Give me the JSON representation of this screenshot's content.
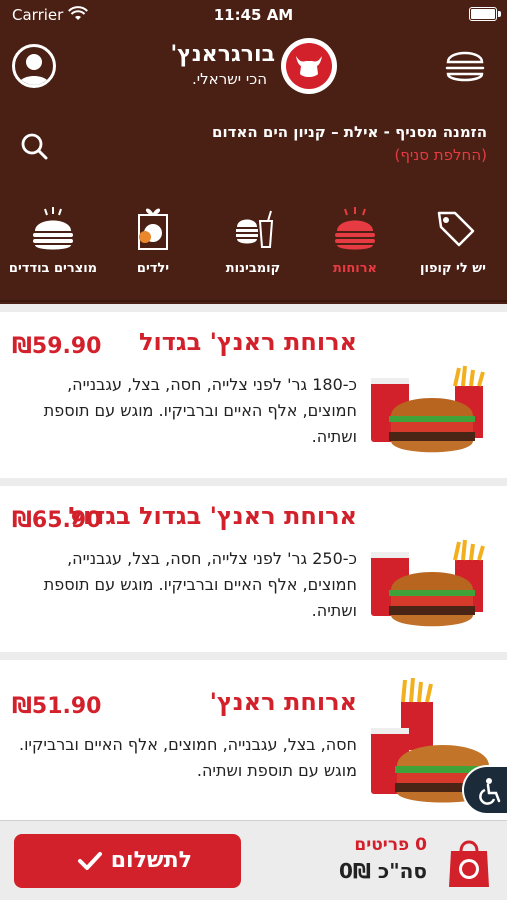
{
  "status": {
    "carrier": "Carrier",
    "time": "11:45 AM"
  },
  "header": {
    "logo_name": "בורגראנץ'",
    "logo_tagline": "הכי ישראלי."
  },
  "branch": {
    "line": "הזמנה מסניף - אילת – קניון הים האדום",
    "change_label": "(החלפת סניף)"
  },
  "categories": [
    {
      "label": "יש לי קופון",
      "icon": "coupon-tag-icon",
      "active": false
    },
    {
      "label": "ארוחות",
      "icon": "burger-icon",
      "active": true
    },
    {
      "label": "קומבינות",
      "icon": "combo-icon",
      "active": false
    },
    {
      "label": "ילדים",
      "icon": "kids-meal-icon",
      "active": false
    },
    {
      "label": "מוצרים בודדים",
      "icon": "single-burger-icon",
      "active": false
    }
  ],
  "items": [
    {
      "title": "ארוחת ראנץ' בגדול",
      "price": "₪59.90",
      "desc": "כ-180 גר' לפני צלייה, חסה, בצל, עגבנייה, חמוצים, אלף האיים וברביקיו. מוגש עם תוספת ושתיה.",
      "image": "meal-image"
    },
    {
      "title": "ארוחת ראנץ' בגדול בגדול",
      "price": "₪65.90",
      "desc": "כ-250 גר' לפני צלייה, חסה, בצל, עגבנייה, חמוצים, אלף האיים וברביקיו. מוגש עם תוספת ושתיה.",
      "image": "meal-image"
    },
    {
      "title": "ארוחת ראנץ'",
      "price": "₪51.90",
      "desc": "חסה, בצל, עגבנייה, חמוצים, אלף האיים וברביקיו. מוגש עם תוספת ושתיה.",
      "image": "meal-image"
    }
  ],
  "footer": {
    "items_count": "0 פריטים",
    "total": "סה\"כ 0₪",
    "pay_label": "לתשלום"
  },
  "colors": {
    "brown": "#4a1f14",
    "red": "#d3212c",
    "light_red": "#e63b43"
  }
}
